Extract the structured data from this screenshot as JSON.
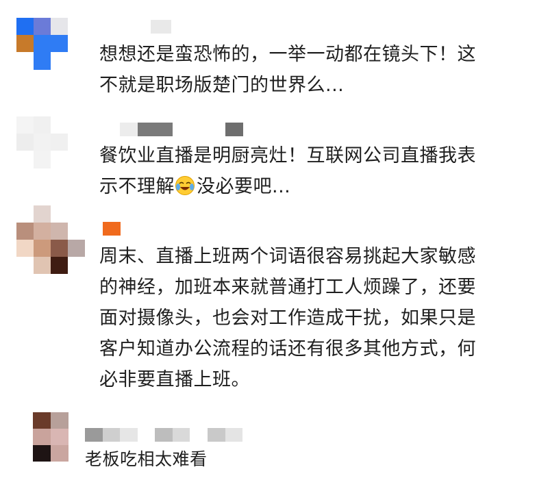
{
  "comments": [
    {
      "text": "想想还是蛮恐怖的，一举一动都在镜头下！这\n不就是职场版楚门的世界么...",
      "avatar_colors": [
        "#1f6ff2",
        "#6b7bd8",
        "#e6e6ea",
        "#ffffff",
        "#c77a2a",
        "#2f7cf4",
        "#2f7cf4",
        "#ffffff",
        "#ffffff",
        "#2f7cf4",
        "#ffffff",
        "#ffffff"
      ],
      "name_blur_colors": [
        "#e9e9e9"
      ]
    },
    {
      "text_before_emoji": "餐饮业直播是明厨亮灶！互联网公司直播我表\n示不理解",
      "emoji": "crying-laughing-emoji",
      "text_after_emoji": "没必要吧...",
      "avatar_colors": [
        "#f4f4f4",
        "#f0f0f0",
        "#ffffff",
        "#ffffff",
        "#ededed",
        "#f2f2f2",
        "#f0f0f0",
        "#ffffff",
        "#ffffff",
        "#f3f3f3",
        "#ffffff",
        "#ffffff"
      ],
      "name_blur_colors": [
        "#ececec",
        "#7a7a7a",
        "#7a7a7a",
        "#ffffff",
        "#ffffff",
        "#ffffff",
        "#6e6e6e"
      ]
    },
    {
      "text": "周末、直播上班两个词语很容易挑起大家敏感\n的神经，加班本来就普通打工人烦躁了，还要\n面对摄像头，也会对工作造成干扰，如果只是\n客户知道办公流程的话还有很多其他方式，何\n必非要直播上班。",
      "avatar_colors": [
        "#ffffff",
        "#e2d4cf",
        "#ffffff",
        "#ffffff",
        "#b98f7c",
        "#d3b0a0",
        "#cfb6ad",
        "#ffffff",
        "#f1d7c5",
        "#cc9a7c",
        "#8a5a49",
        "#b8a8a6",
        "#ffffff",
        "#e0c4b2",
        "#3f1c12",
        "#ffffff"
      ],
      "name_blur_colors": [
        "#f06a1d"
      ]
    },
    {
      "text": "老板吃相太难看",
      "avatar_colors": [
        "#6a3b2a",
        "#b7a09a",
        "#c9a39c",
        "#d9b6b3",
        "#1e1414",
        "#caa6a0"
      ],
      "name_blur_colors": [
        "#9a9a9a",
        "#cfcfcf",
        "#e6e6e6",
        "#ffffff",
        "#bdbdbd",
        "#d9d9d9",
        "#ffffff",
        "#c9c9c9",
        "#e4e4e4"
      ]
    }
  ]
}
